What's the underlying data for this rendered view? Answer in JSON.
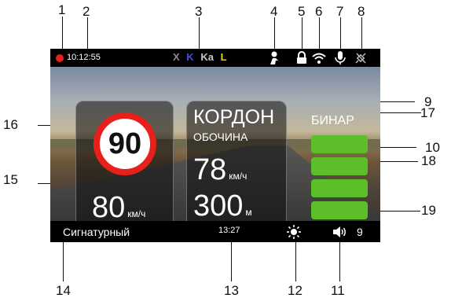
{
  "callouts": {
    "c1": "1",
    "c2": "2",
    "c3": "3",
    "c4": "4",
    "c5": "5",
    "c6": "6",
    "c7": "7",
    "c8": "8",
    "c9": "9",
    "c10": "10",
    "c11": "11",
    "c12": "12",
    "c13": "13",
    "c14": "14",
    "c15": "15",
    "c16": "16",
    "c17": "17",
    "c18": "18",
    "c19": "19"
  },
  "status": {
    "time": "10:12:55",
    "bands": [
      {
        "label": "X",
        "color": "#8c8c8c"
      },
      {
        "label": "K",
        "color": "#4a4ae0"
      },
      {
        "label": "Ka",
        "color": "#c8c8c8"
      },
      {
        "label": "L",
        "color": "#e6d21e"
      }
    ]
  },
  "speed_sign": {
    "limit": "90",
    "speed": "80",
    "unit": "км/ч"
  },
  "zone": {
    "title": "КОРДОН",
    "subtitle": "ОБОЧИНА",
    "speed": "78",
    "speed_unit": "км/ч",
    "distance": "300",
    "distance_unit": "м"
  },
  "signal": {
    "label": "БИНАР",
    "bars": 4
  },
  "bottom": {
    "mode": "Сигнатурный",
    "time": "13:27",
    "volume": "9"
  },
  "colors": {
    "record": "#e8201c",
    "sign_border": "#e8201c",
    "signal_bar": "#5cbf2a"
  }
}
